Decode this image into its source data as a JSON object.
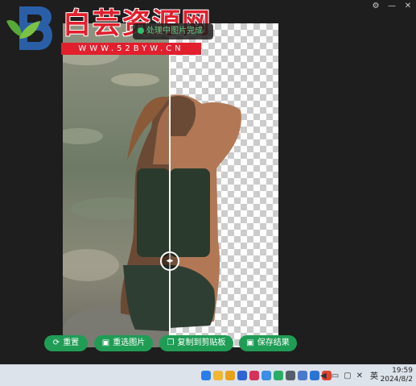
{
  "window": {
    "settings_icon": "gear-icon",
    "minimize_symbol": "—",
    "close_symbol": "✕"
  },
  "watermark": {
    "title": "白芸资源网",
    "url": "WWW.52BYW.CN",
    "colors": {
      "red": "#e21f2d",
      "green": "#57a93a",
      "blue": "#2a5fa8"
    }
  },
  "status": {
    "text": "处理中图片完成"
  },
  "compare": {
    "split_fraction": 0.5,
    "handle_icon": "left-right-arrows-icon",
    "handle_symbol": "◂▸"
  },
  "actions": [
    {
      "label": "重置",
      "icon": "refresh-icon",
      "symbol": "⟳"
    },
    {
      "label": "重选图片",
      "icon": "image-icon",
      "symbol": "▣"
    },
    {
      "label": "复制到剪贴板",
      "icon": "copy-icon",
      "symbol": "❐"
    },
    {
      "label": "保存结果",
      "icon": "save-image-icon",
      "symbol": "▣"
    }
  ],
  "accent_color": "#1f9d55",
  "taskbar": {
    "tray_icons": [
      {
        "name": "app-icon-1",
        "color": "#2b7de9"
      },
      {
        "name": "folder-icon",
        "color": "#f2b632"
      },
      {
        "name": "shield-icon",
        "color": "#e8a21a"
      },
      {
        "name": "app-icon-2",
        "color": "#2f64d6"
      },
      {
        "name": "app-icon-3",
        "color": "#d8305c"
      },
      {
        "name": "cloud-icon",
        "color": "#3a8ee6"
      },
      {
        "name": "wechat-icon",
        "color": "#2aae67"
      },
      {
        "name": "app-icon-4",
        "color": "#555f6b"
      },
      {
        "name": "app-icon-5",
        "color": "#4a79c9"
      },
      {
        "name": "app-icon-6",
        "color": "#2a74d5"
      },
      {
        "name": "app-icon-7",
        "color": "#e0432e"
      }
    ],
    "input_method": "英",
    "time": "19:59",
    "date": "2024/8/2"
  }
}
